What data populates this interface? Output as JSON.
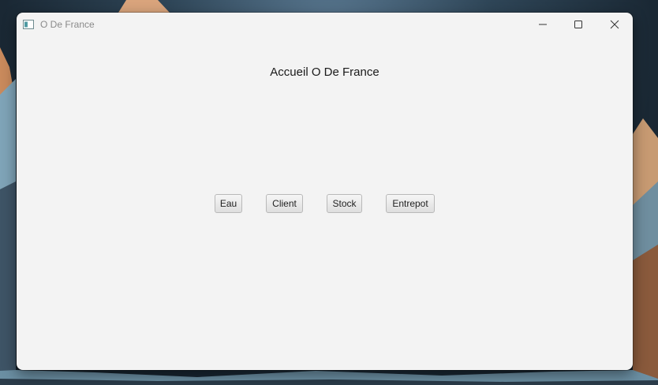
{
  "window": {
    "title": "O De France",
    "icon": "app-window-icon",
    "controls": {
      "minimize_icon": "minimize-icon",
      "maximize_icon": "maximize-icon",
      "close_icon": "close-icon"
    }
  },
  "main": {
    "heading": "Accueil O De France",
    "buttons": {
      "eau": "Eau",
      "client": "Client",
      "stock": "Stock",
      "entrepot": "Entrepot"
    }
  },
  "colors": {
    "window_background": "#f3f3f3",
    "title_text": "#8a8a8a",
    "button_border": "#b9b9b9"
  }
}
